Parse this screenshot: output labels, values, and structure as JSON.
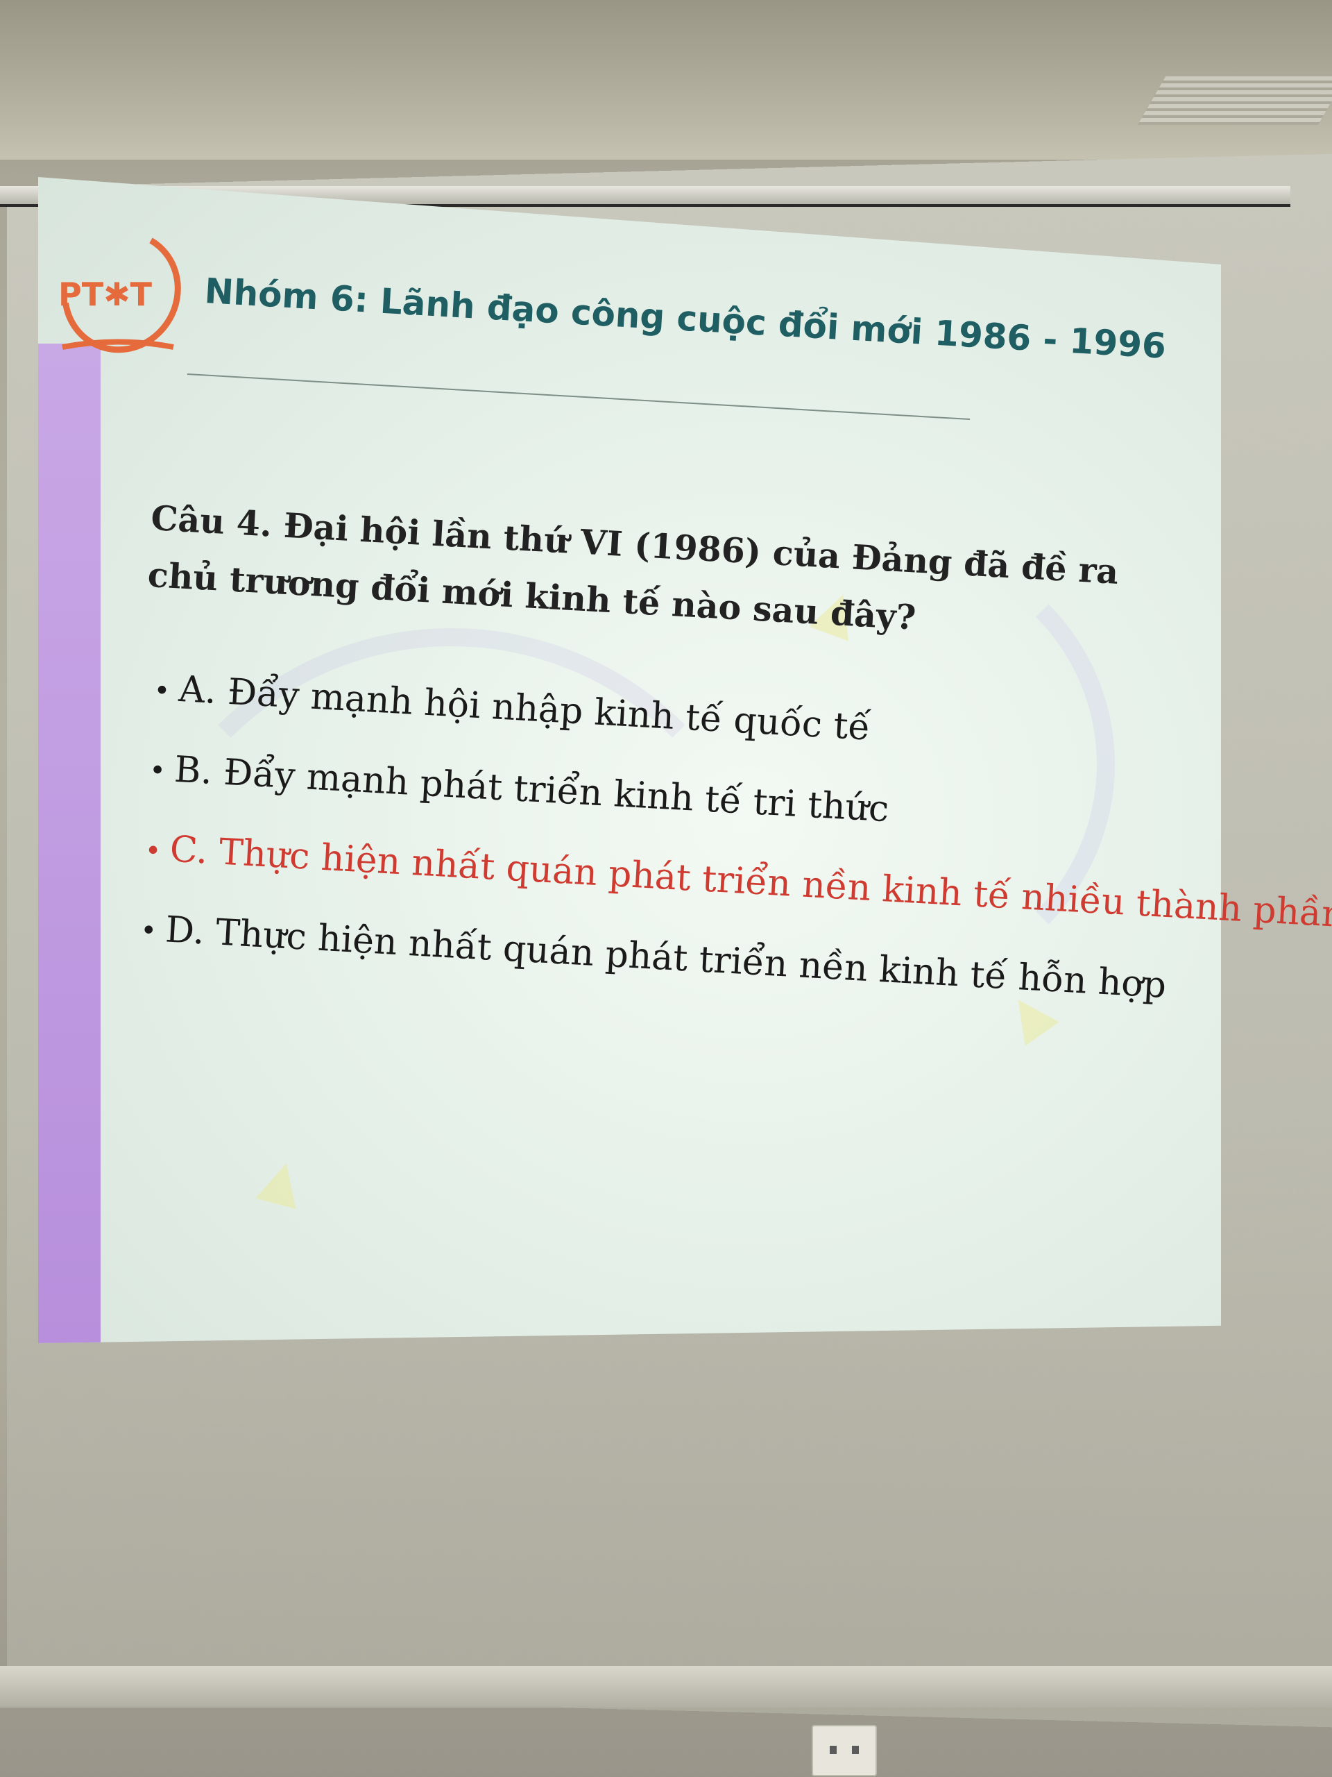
{
  "slide": {
    "logo_text": "PT✱T",
    "title": "Nhóm 6: Lãnh đạo công cuộc đổi mới 1986 - 1996",
    "question": "Câu 4. Đại hội lần thứ VI (1986) của Đảng đã đề ra chủ trương đổi mới kinh tế nào sau đây?",
    "options": [
      {
        "text": "A. Đẩy mạnh hội nhập kinh tế quốc tế",
        "color": "#1a1a1a"
      },
      {
        "text": "B. Đẩy mạnh phát triển kinh tế tri thức",
        "color": "#1a1a1a"
      },
      {
        "text": "C. Thực hiện nhất quán phát triển nền kinh tế nhiều thành phần",
        "color": "#cf3b30"
      },
      {
        "text": "D. Thực hiện nhất quán phát triển nền kinh tế hỗn hợp",
        "color": "#1a1a1a"
      }
    ],
    "bullet": "•"
  },
  "colors": {
    "title": "#1f5e63",
    "highlight": "#cf3b30",
    "side_bar": "#c9a8e6",
    "logo": "#e56a3c"
  }
}
